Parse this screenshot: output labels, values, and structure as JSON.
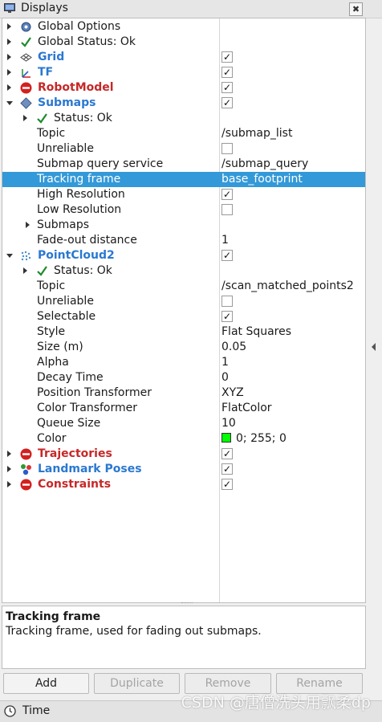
{
  "panel": {
    "title": "Displays",
    "close_glyph": "✖"
  },
  "tree": {
    "global_options": "Global Options",
    "global_status": "Global Status: Ok",
    "grid": {
      "label": "Grid",
      "checked": "✓"
    },
    "tf": {
      "label": "TF",
      "checked": "✓"
    },
    "robotmodel": {
      "label": "RobotModel",
      "checked": "✓"
    },
    "submaps": {
      "label": "Submaps",
      "checked": "✓",
      "status": "Status: Ok",
      "topic_label": "Topic",
      "topic_value": "/submap_list",
      "unreliable_label": "Unreliable",
      "query_label": "Submap query service",
      "query_value": "/submap_query",
      "tracking_label": "Tracking frame",
      "tracking_value": "base_footprint",
      "highres_label": "High Resolution",
      "highres_checked": "✓",
      "lowres_label": "Low Resolution",
      "submaps_label": "Submaps",
      "fade_label": "Fade-out distance",
      "fade_value": "1"
    },
    "pointcloud2": {
      "label": "PointCloud2",
      "checked": "✓",
      "status": "Status: Ok",
      "topic_label": "Topic",
      "topic_value": "/scan_matched_points2",
      "unreliable_label": "Unreliable",
      "selectable_label": "Selectable",
      "selectable_checked": "✓",
      "style_label": "Style",
      "style_value": "Flat Squares",
      "size_label": "Size (m)",
      "size_value": "0.05",
      "alpha_label": "Alpha",
      "alpha_value": "1",
      "decay_label": "Decay Time",
      "decay_value": "0",
      "postrans_label": "Position Transformer",
      "postrans_value": "XYZ",
      "coltrans_label": "Color Transformer",
      "coltrans_value": "FlatColor",
      "queue_label": "Queue Size",
      "queue_value": "10",
      "color_label": "Color",
      "color_value": "0; 255; 0",
      "color_hex": "#00ff00"
    },
    "trajectories": {
      "label": "Trajectories",
      "checked": "✓"
    },
    "landmark": {
      "label": "Landmark Poses",
      "checked": "✓"
    },
    "constraints": {
      "label": "Constraints",
      "checked": "✓"
    }
  },
  "help": {
    "title": "Tracking frame",
    "body": "Tracking frame, used for fading out submaps."
  },
  "buttons": {
    "add": "Add",
    "duplicate": "Duplicate",
    "remove": "Remove",
    "rename": "Rename"
  },
  "footer": {
    "label": "Time"
  },
  "watermark": "CSDN @唐僧洗头用飘柔dp",
  "colors": {
    "selection": "#3399d8",
    "blue_label": "#2b78d0",
    "red_label": "#c62828"
  }
}
